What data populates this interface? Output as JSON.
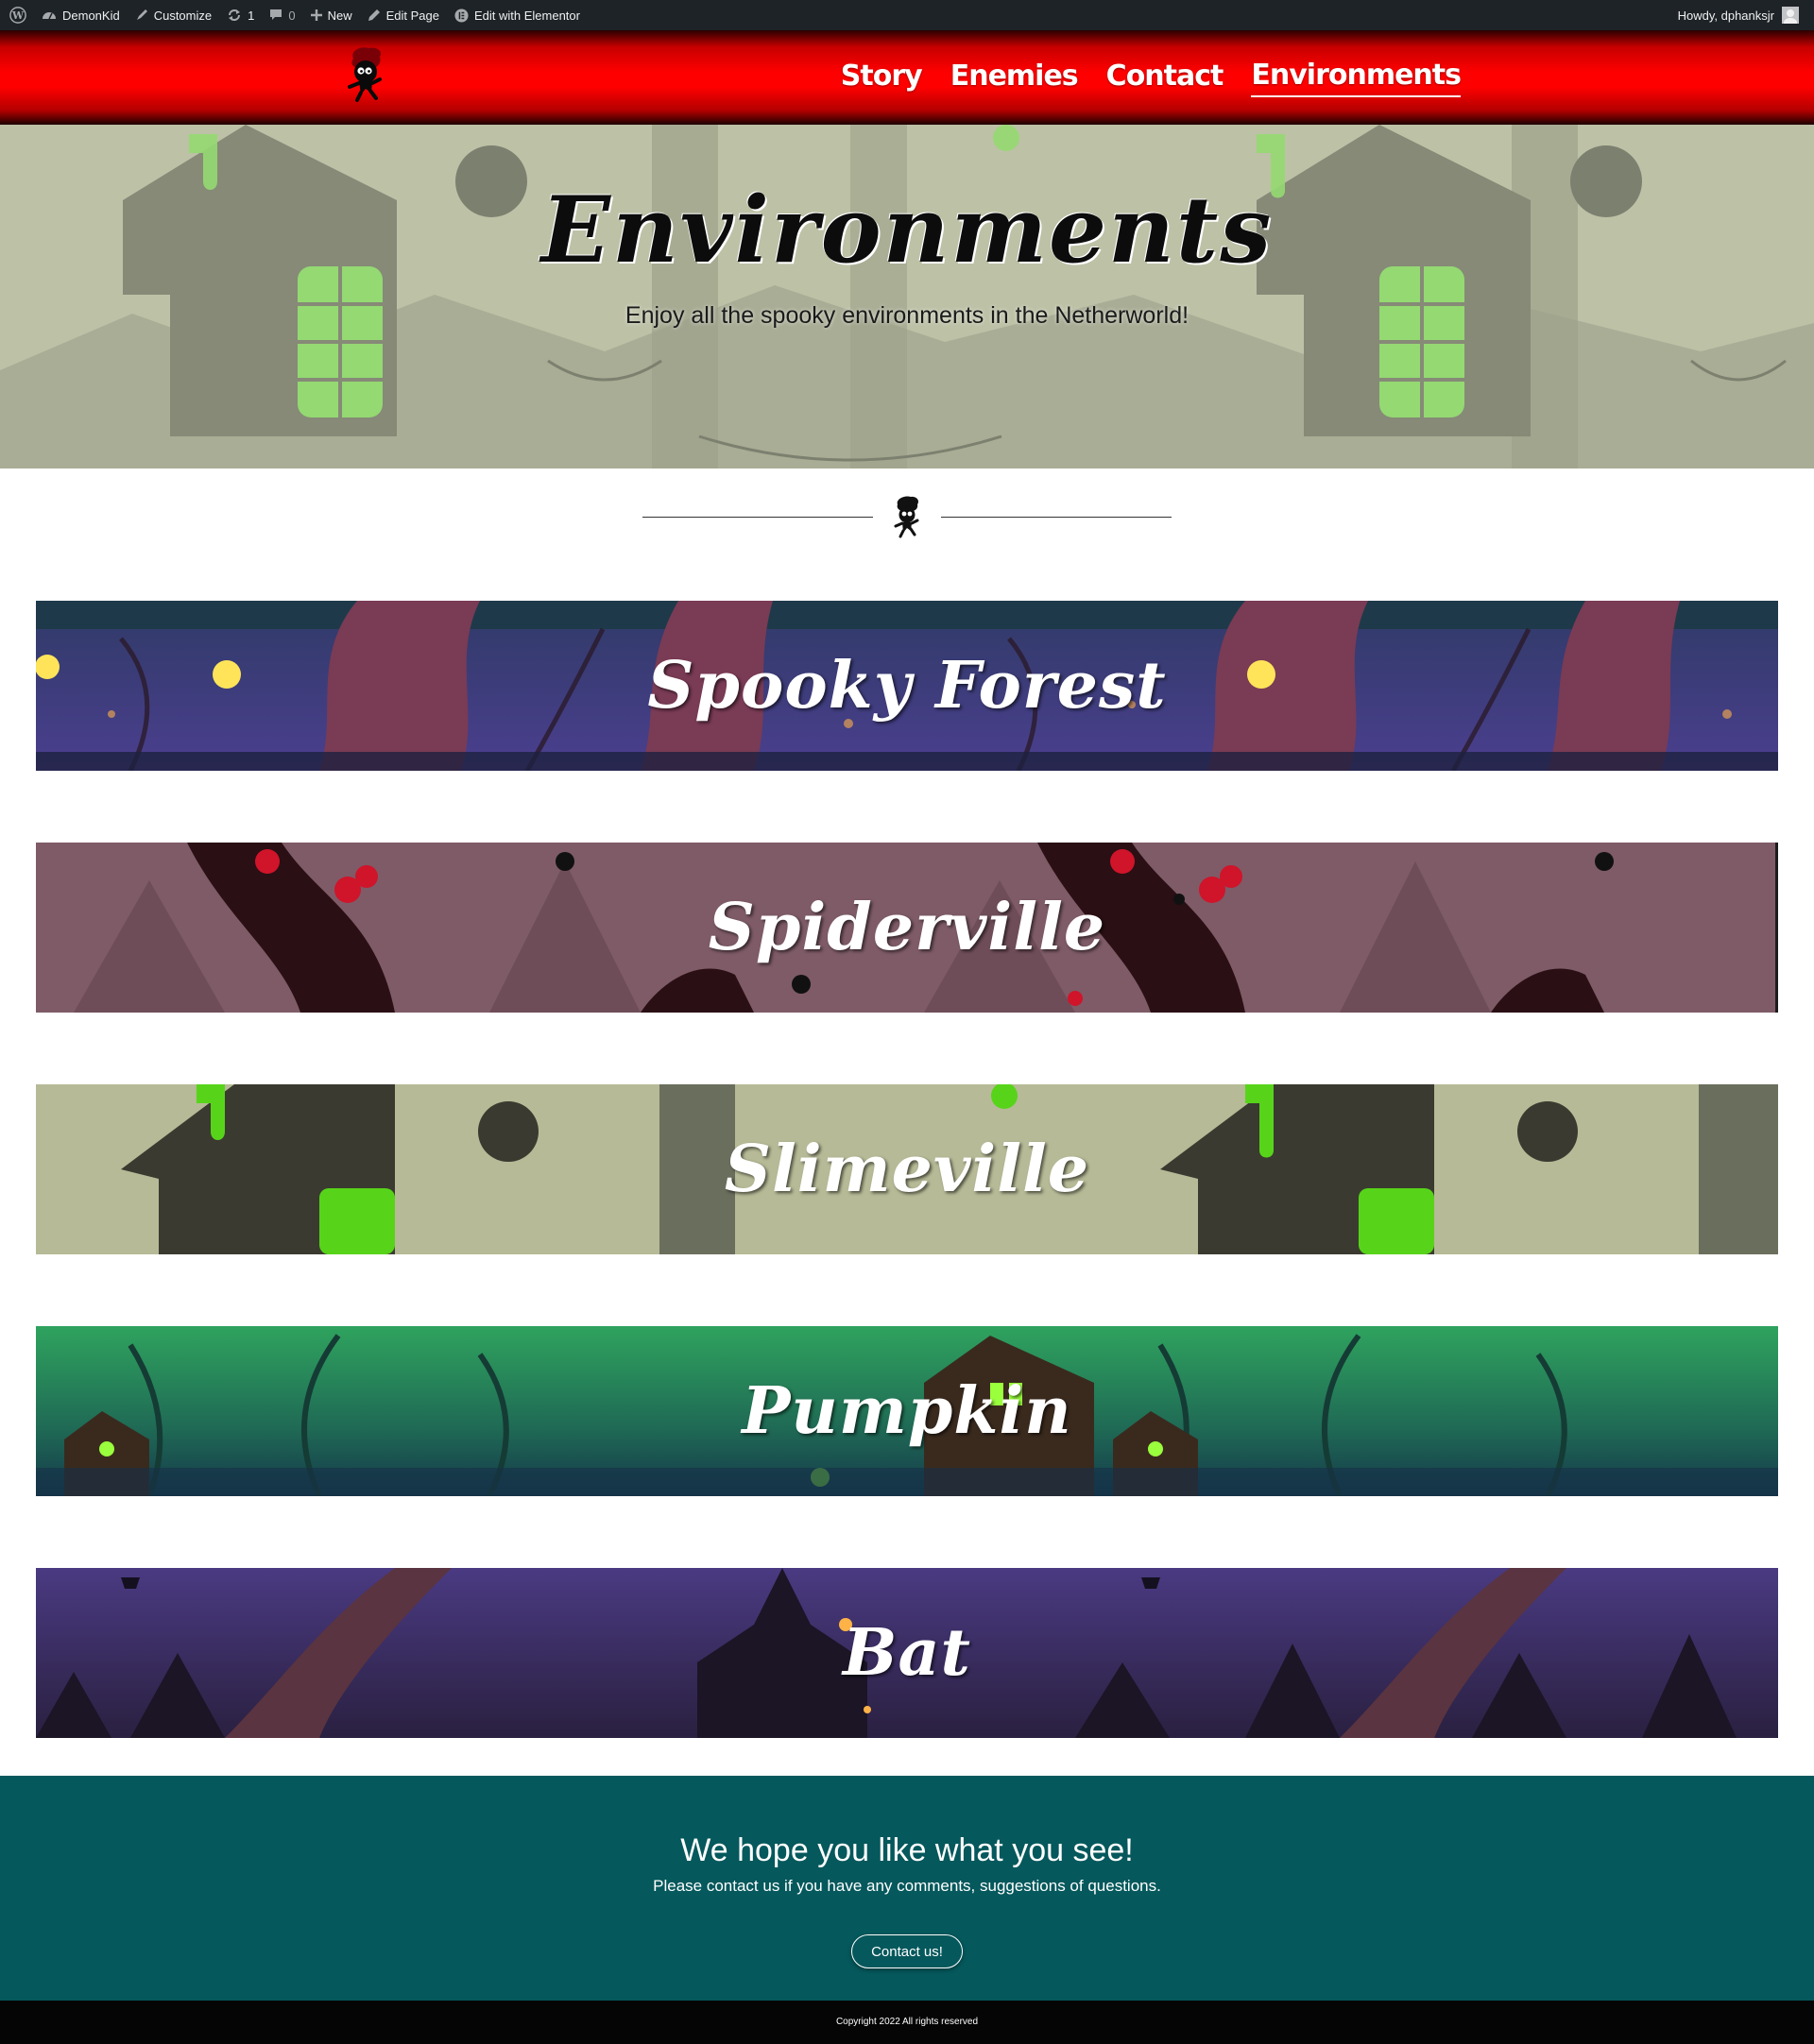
{
  "admin_bar": {
    "site_name": "DemonKid",
    "customize": "Customize",
    "updates_count": "1",
    "comments_count": "0",
    "new": "New",
    "edit_page": "Edit Page",
    "edit_elementor": "Edit with Elementor",
    "howdy": "Howdy, dphanksjr",
    "icons": [
      "wordpress-icon",
      "dashboard-icon",
      "brush-icon",
      "refresh-icon",
      "comment-icon",
      "plus-icon",
      "pencil-icon",
      "elementor-icon",
      "avatar-icon"
    ]
  },
  "header": {
    "logo_icon": "demon-kid-logo",
    "nav": [
      {
        "label": "Story",
        "active": false
      },
      {
        "label": "Enemies",
        "active": false
      },
      {
        "label": "Contact",
        "active": false
      },
      {
        "label": "Environments",
        "active": true
      }
    ],
    "colors": {
      "primary": "#ff0000",
      "dark": "#1c0000"
    }
  },
  "hero": {
    "title": "Environments",
    "subtitle": "Enjoy all the spooky environments in the Netherworld!"
  },
  "environments": [
    {
      "title": "Spooky Forest",
      "theme": "purple-forest"
    },
    {
      "title": "Spiderville",
      "theme": "mauve-spiders"
    },
    {
      "title": "Slimeville",
      "theme": "green-slime"
    },
    {
      "title": "Pumpkin",
      "theme": "teal-forest"
    },
    {
      "title": "Bat",
      "theme": "purple-night"
    }
  ],
  "cta": {
    "heading": "We hope you like what you see!",
    "text": "Please contact us if you have any comments, suggestions of questions.",
    "button": "Contact us!",
    "color": "#05585c"
  },
  "footer": {
    "copyright": "Copyright 2022 All rights reserved"
  }
}
